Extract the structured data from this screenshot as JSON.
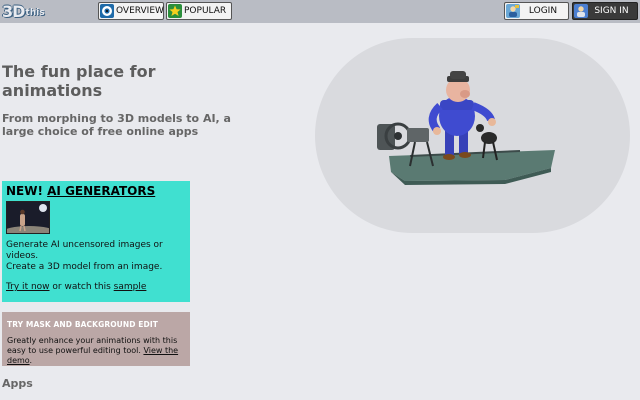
{
  "header": {
    "logo_text": "3D",
    "logo_suffix": "this",
    "nav": {
      "overview_label": "OVERVIEW",
      "popular_label": "POPULAR"
    },
    "login_label": "LOGIN",
    "signin_label": "SIGN IN"
  },
  "hero": {
    "title": "The fun place for animations",
    "subtitle": "From morphing to 3D models to AI, a large choice of free online apps"
  },
  "ai_box": {
    "title_prefix": "NEW! ",
    "title_link": "AI GENERATORS",
    "line1": "Generate AI uncensored images or videos.",
    "line2": "Create a 3D model from an image.",
    "try_link": "Try it now",
    "middle": " or watch this ",
    "sample_link": "sample"
  },
  "mask_box": {
    "title": "TRY MASK AND BACKGROUND EDIT",
    "text": "Greatly enhance your animations with this easy to use powerful editing tool. ",
    "demo_link": "View the demo",
    "end": "."
  },
  "apps": {
    "heading": "Apps"
  },
  "colors": {
    "background": "#e9eaee",
    "topbar": "#b9bcc4",
    "ai_box": "#40e0d0",
    "mask_box": "#bba7a6",
    "signin": "#3a3a3a"
  },
  "icons": [
    "eye-icon",
    "star-icon",
    "login-user-icon",
    "signin-user-icon"
  ]
}
